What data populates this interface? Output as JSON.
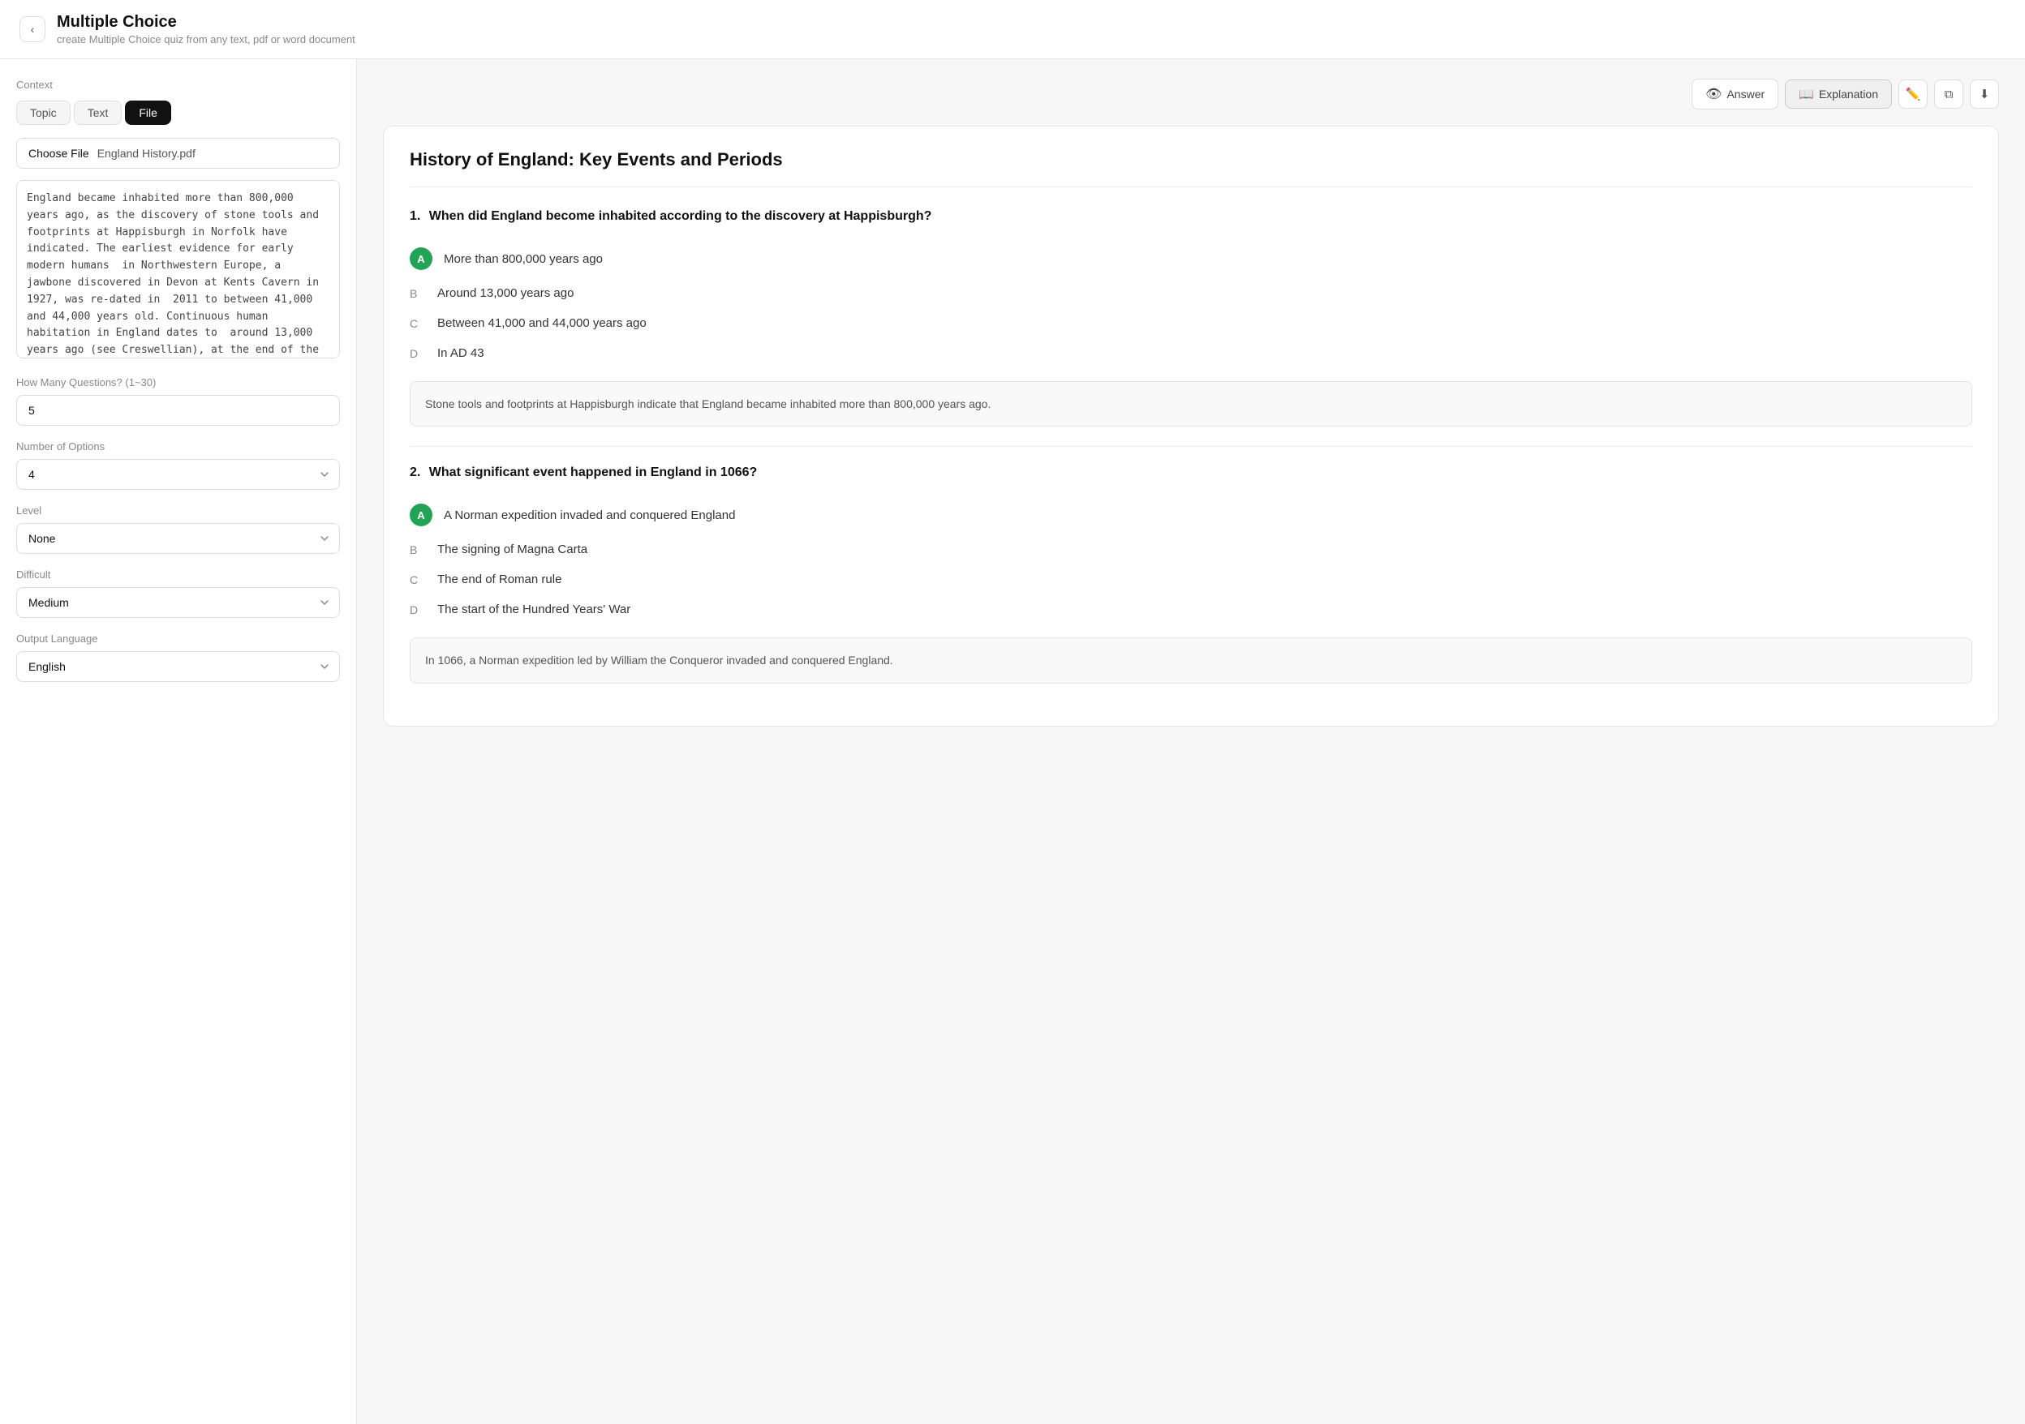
{
  "header": {
    "back_label": "‹",
    "title": "Multiple Choice",
    "subtitle": "create Multiple Choice quiz from any text, pdf or word document"
  },
  "sidebar": {
    "context_label": "Context",
    "tabs": [
      {
        "label": "Topic",
        "active": false
      },
      {
        "label": "Text",
        "active": false
      },
      {
        "label": "File",
        "active": true
      }
    ],
    "file_input": {
      "choose_label": "Choose File",
      "file_name": "England History.pdf"
    },
    "text_content": "England became inhabited more than 800,000 years ago, as the discovery of stone tools and footprints at Happisburgh in Norfolk have indicated. The earliest evidence for early modern humans  in Northwestern Europe, a jawbone discovered in Devon at Kents Cavern in 1927, was re-dated in  2011 to between 41,000 and 44,000 years old. Continuous human habitation in England dates to  around 13,000 years ago (see Creswellian), at the end of the Last Glacial Period. The region has  numerous remains from the",
    "num_questions_label": "How Many Questions? (1~30)",
    "num_questions_value": "5",
    "num_options_label": "Number of Options",
    "num_options_value": "4",
    "level_label": "Level",
    "level_value": "None",
    "difficult_label": "Difficult",
    "difficult_value": "Medium",
    "output_language_label": "Output Language",
    "output_language_value": "English"
  },
  "toolbar": {
    "answer_label": "Answer",
    "explanation_label": "Explanation",
    "edit_icon": "✏",
    "copy_icon": "⧉",
    "download_icon": "⬇"
  },
  "quiz": {
    "title": "History of England: Key Events and Periods",
    "questions": [
      {
        "num": "1.",
        "text": "When did England become inhabited according to the discovery at Happisburgh?",
        "options": [
          {
            "letter": "A",
            "text": "More than 800,000 years ago",
            "correct": true
          },
          {
            "letter": "B",
            "text": "Around 13,000 years ago",
            "correct": false
          },
          {
            "letter": "C",
            "text": "Between 41,000 and 44,000 years ago",
            "correct": false
          },
          {
            "letter": "D",
            "text": "In AD 43",
            "correct": false
          }
        ],
        "explanation": "Stone tools and footprints at Happisburgh indicate that England became inhabited more than 800,000 years ago."
      },
      {
        "num": "2.",
        "text": "What significant event happened in England in 1066?",
        "options": [
          {
            "letter": "A",
            "text": "A Norman expedition invaded and conquered England",
            "correct": true
          },
          {
            "letter": "B",
            "text": "The signing of Magna Carta",
            "correct": false
          },
          {
            "letter": "C",
            "text": "The end of Roman rule",
            "correct": false
          },
          {
            "letter": "D",
            "text": "The start of the Hundred Years' War",
            "correct": false
          }
        ],
        "explanation": "In 1066, a Norman expedition led by William the Conqueror invaded and conquered England."
      }
    ]
  }
}
